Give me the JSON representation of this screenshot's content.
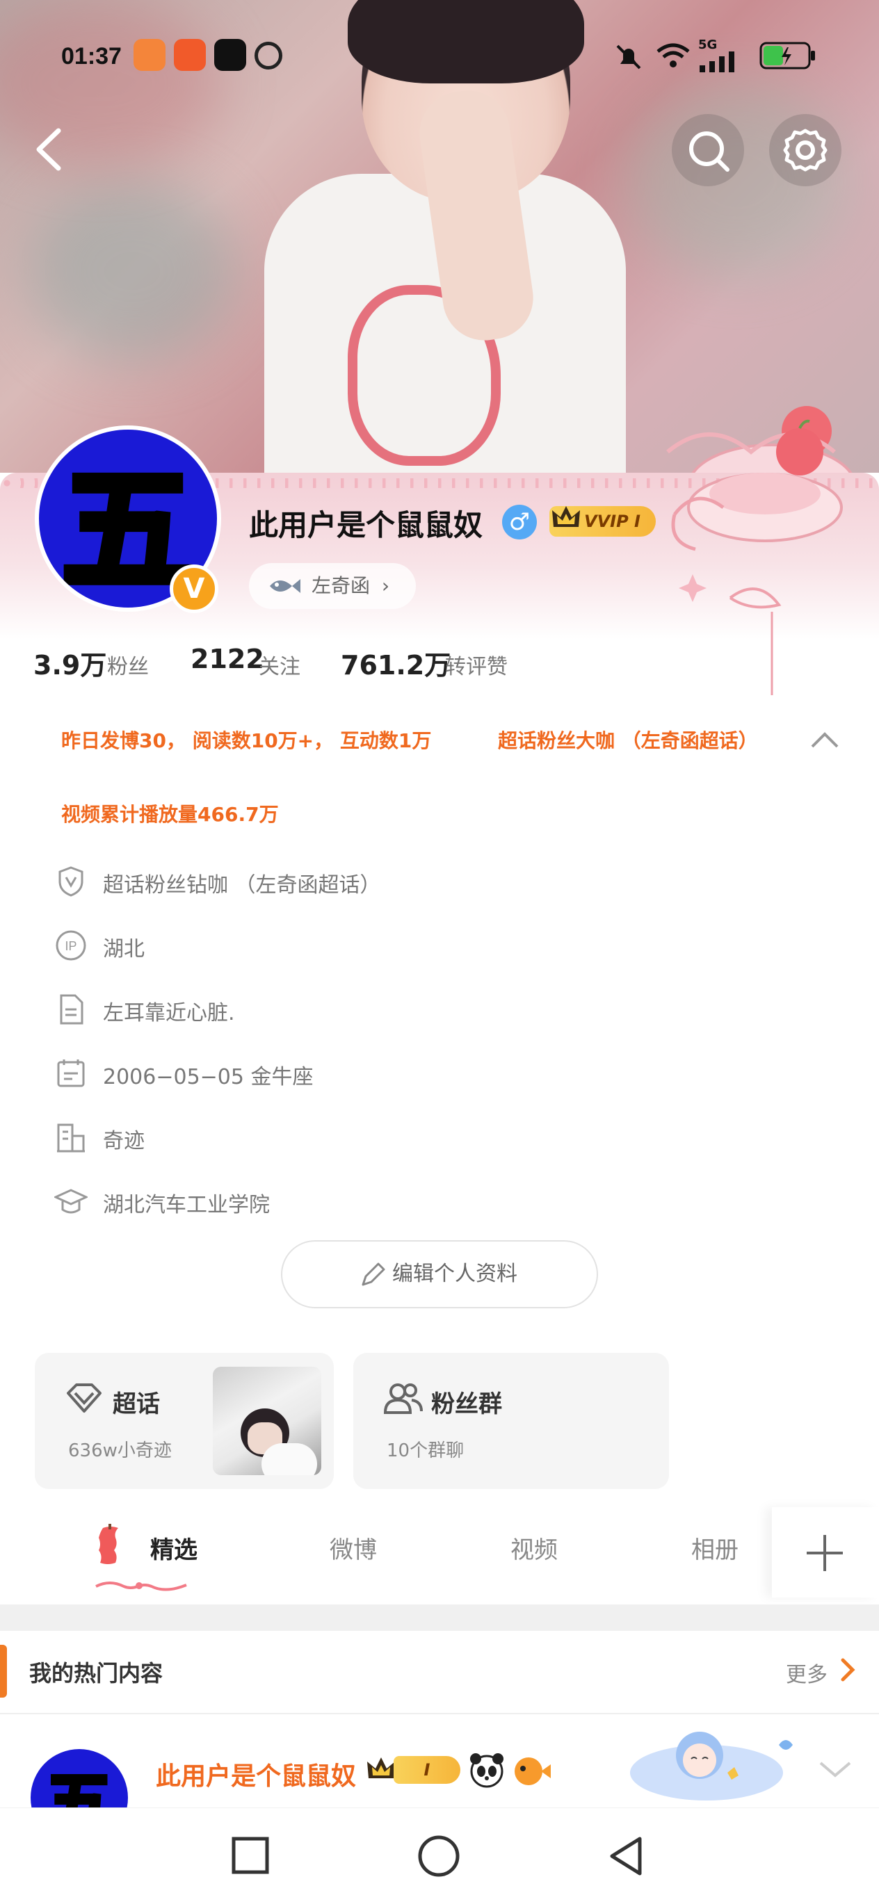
{
  "status_bar": {
    "time": "01:37",
    "network": "5G"
  },
  "profile": {
    "name": "此用户是个鼠鼠奴",
    "gender_symbol": "♂",
    "vip_label": "VVIP I",
    "avatar_char": "五",
    "verified_badge": "V",
    "tag": "左奇函",
    "tag_chevron": "›"
  },
  "stats": [
    {
      "value": "3.9万",
      "label": "粉丝"
    },
    {
      "value": "2122",
      "label": "关注"
    },
    {
      "value": "761.2万",
      "label": "转评赞"
    }
  ],
  "highlights": {
    "line1": "昨日发博30， 阅读数10万+， 互动数1万",
    "line1_right": "超话粉丝大咖 （左奇函超话）",
    "line2": "视频累计播放量466.7万"
  },
  "info": [
    {
      "icon": "shield-v-icon",
      "text": "超话粉丝钻咖 （左奇函超话）"
    },
    {
      "icon": "ip-icon",
      "text": "湖北"
    },
    {
      "icon": "document-icon",
      "text": "左耳靠近心脏."
    },
    {
      "icon": "calendar-icon",
      "text": "2006−05−05  金牛座"
    },
    {
      "icon": "company-icon",
      "text": "奇迹"
    },
    {
      "icon": "graduation-cap-icon",
      "text": "湖北汽车工业学院"
    }
  ],
  "edit_profile_label": "编辑个人资料",
  "cards": {
    "supertopic": {
      "title": "超话",
      "subtitle": "636w小奇迹"
    },
    "fan_group": {
      "title": "粉丝群",
      "subtitle": "10个群聊"
    }
  },
  "tabs": [
    {
      "label": "精选",
      "active": true
    },
    {
      "label": "微博",
      "active": false
    },
    {
      "label": "视频",
      "active": false
    },
    {
      "label": "相册",
      "active": false
    }
  ],
  "hot_section": {
    "title": "我的热门内容",
    "more": "更多"
  },
  "post": {
    "author": "此用户是个鼠鼠奴",
    "vip_label": "I"
  },
  "colors": {
    "accent_orange": "#f0691f",
    "avatar_blue": "#1a1ad6",
    "gender_blue": "#55a9f5",
    "vip_gold": "#f6b53a"
  }
}
